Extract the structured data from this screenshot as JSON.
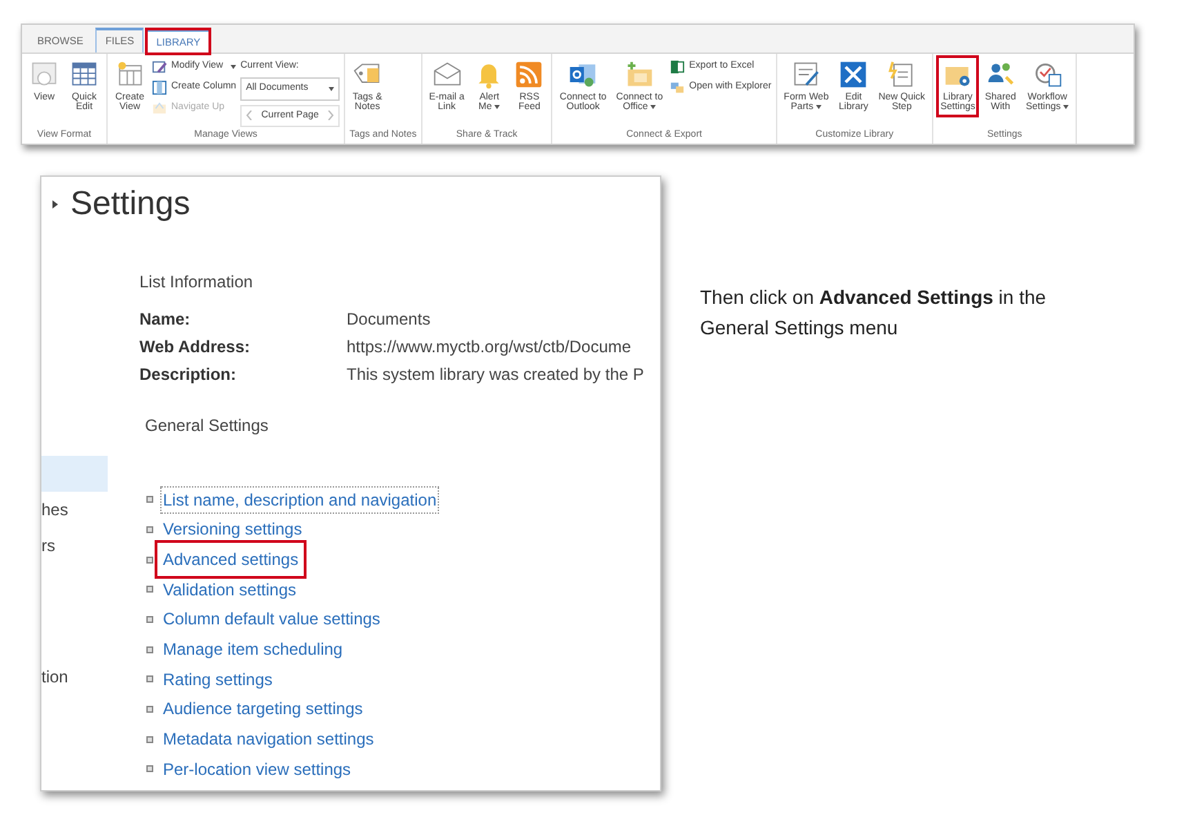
{
  "ribbon": {
    "tabs": [
      {
        "label": "BROWSE",
        "selected": false,
        "contextual": false,
        "highlighted": false
      },
      {
        "label": "FILES",
        "selected": false,
        "contextual": true,
        "highlighted": false
      },
      {
        "label": "LIBRARY",
        "selected": true,
        "contextual": true,
        "highlighted": true
      }
    ],
    "groups": [
      {
        "label": "View Format",
        "items": [
          {
            "kind": "large",
            "label": "View",
            "disabled": false,
            "menu": false,
            "highlighted": false
          },
          {
            "kind": "large",
            "label": "Quick\nEdit",
            "disabled": false,
            "menu": false,
            "highlighted": false
          }
        ]
      },
      {
        "label": "Manage Views",
        "items": [
          {
            "kind": "large",
            "label": "Create\nView",
            "disabled": false,
            "menu": false,
            "highlighted": false
          },
          {
            "kind": "stack",
            "items": [
              {
                "label": "Modify View",
                "disabled": false,
                "menu": true
              },
              {
                "label": "Create Column",
                "disabled": false,
                "menu": false
              },
              {
                "label": "Navigate Up",
                "disabled": true,
                "menu": false
              }
            ]
          },
          {
            "kind": "view_picker",
            "label": "Current View:",
            "value": "All Documents",
            "pager": "Current Page"
          }
        ]
      },
      {
        "label": "Tags and Notes",
        "items": [
          {
            "kind": "large",
            "label": "Tags &\nNotes",
            "disabled": false,
            "menu": false,
            "highlighted": false
          }
        ]
      },
      {
        "label": "Share & Track",
        "items": [
          {
            "kind": "large",
            "label": "E-mail a\nLink",
            "disabled": false,
            "menu": false,
            "highlighted": false
          },
          {
            "kind": "large",
            "label": "Alert\nMe",
            "disabled": false,
            "menu": true,
            "highlighted": false
          },
          {
            "kind": "large",
            "label": "RSS\nFeed",
            "disabled": false,
            "menu": false,
            "highlighted": false
          }
        ]
      },
      {
        "label": "Connect & Export",
        "items": [
          {
            "kind": "large",
            "label": "Connect to\nOutlook",
            "disabled": false,
            "menu": false,
            "highlighted": false
          },
          {
            "kind": "large",
            "label": "Connect to\nOffice",
            "disabled": false,
            "menu": true,
            "highlighted": false
          },
          {
            "kind": "stack",
            "items": [
              {
                "label": "Export to Excel",
                "disabled": false,
                "menu": false
              },
              {
                "label": "Open with Explorer",
                "disabled": false,
                "menu": false
              }
            ]
          }
        ]
      },
      {
        "label": "Customize Library",
        "items": [
          {
            "kind": "large",
            "label": "Form Web\nParts",
            "disabled": false,
            "menu": true,
            "highlighted": false
          },
          {
            "kind": "large",
            "label": "Edit\nLibrary",
            "disabled": false,
            "menu": false,
            "highlighted": false
          },
          {
            "kind": "large",
            "label": "New Quick\nStep",
            "disabled": false,
            "menu": false,
            "highlighted": false
          }
        ]
      },
      {
        "label": "Settings",
        "items": [
          {
            "kind": "large",
            "label": "Library\nSettings",
            "disabled": false,
            "menu": false,
            "highlighted": true
          },
          {
            "kind": "large",
            "label": "Shared\nWith",
            "disabled": false,
            "menu": false,
            "highlighted": false
          },
          {
            "kind": "large",
            "label": "Workflow\nSettings",
            "disabled": false,
            "menu": true,
            "highlighted": false
          }
        ]
      }
    ]
  },
  "settings_page": {
    "title": "Settings",
    "left_nav": [
      {
        "selected": true
      },
      {
        "label": "hes",
        "selected": false
      },
      {
        "label": "rs",
        "selected": false
      },
      {
        "label": "tion",
        "selected": false
      }
    ],
    "list_information": {
      "heading": "List Information",
      "rows": [
        {
          "label": "Name:",
          "value": "Documents"
        },
        {
          "label": "Web Address:",
          "value": "https://www.myctb.org/wst/ctb/Docume"
        },
        {
          "label": "Description:",
          "value": "This system library was created by the P"
        }
      ]
    },
    "general_settings": {
      "heading": "General Settings",
      "links": [
        {
          "label": "List name, description and navigation",
          "focused": true,
          "highlighted": false
        },
        {
          "label": "Versioning settings",
          "focused": false,
          "highlighted": false
        },
        {
          "label": "Advanced settings",
          "focused": false,
          "highlighted": true
        },
        {
          "label": "Validation settings",
          "focused": false,
          "highlighted": false
        },
        {
          "label": "Column default value settings",
          "focused": false,
          "highlighted": false
        },
        {
          "label": "Manage item scheduling",
          "focused": false,
          "highlighted": false
        },
        {
          "label": "Rating settings",
          "focused": false,
          "highlighted": false
        },
        {
          "label": "Audience targeting settings",
          "focused": false,
          "highlighted": false
        },
        {
          "label": "Metadata navigation settings",
          "focused": false,
          "highlighted": false
        },
        {
          "label": "Per-location view settings",
          "focused": false,
          "highlighted": false
        }
      ]
    }
  },
  "instruction": "Then click on **Advanced Settings** in the General Settings menu"
}
